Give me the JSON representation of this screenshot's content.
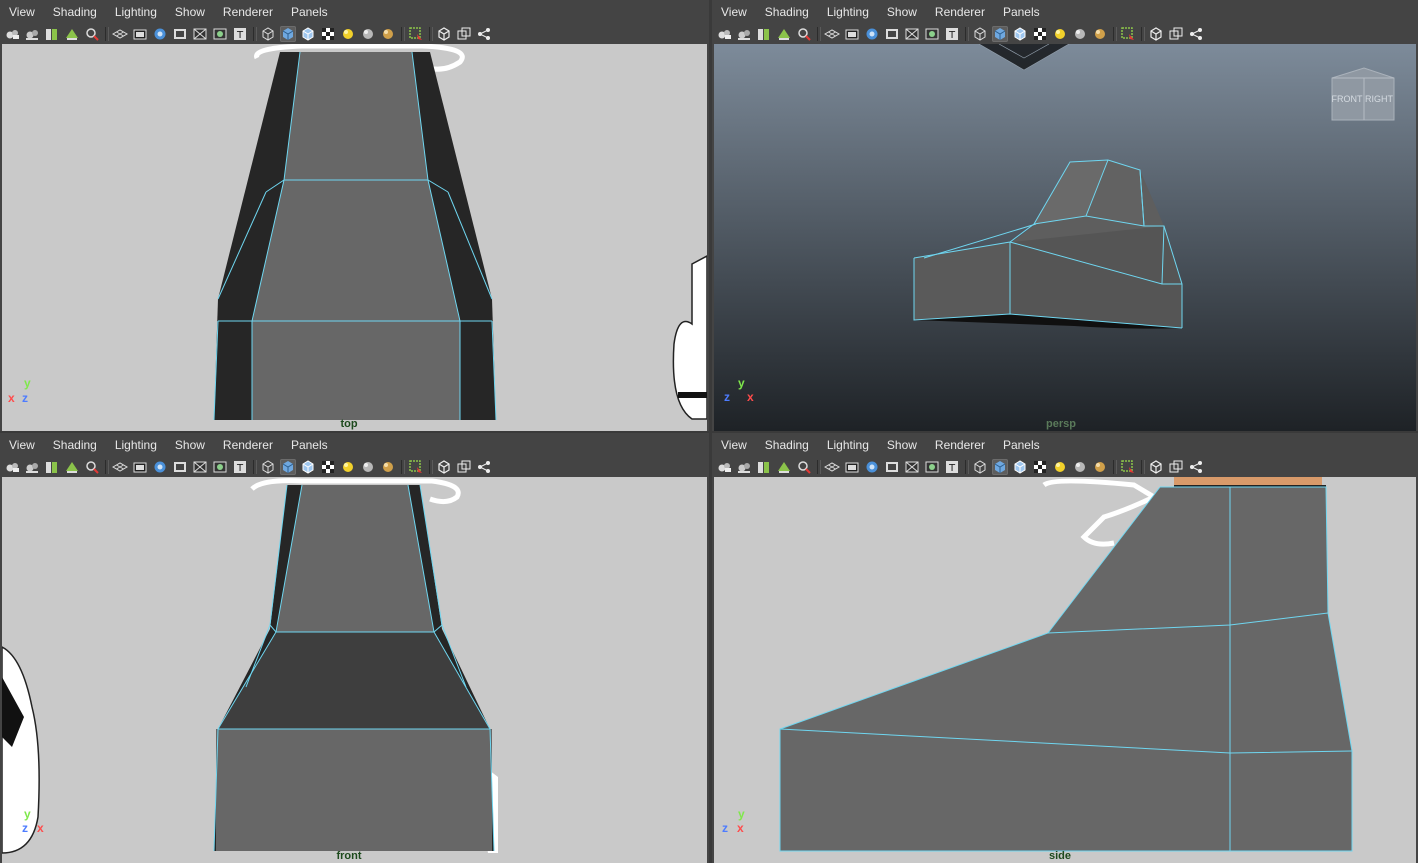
{
  "menu": [
    "View",
    "Shading",
    "Lighting",
    "Show",
    "Renderer",
    "Panels"
  ],
  "toolbar_icons": [
    "camera-icon",
    "camera-attributes-icon",
    "bookmark-icon",
    "image-plane-icon",
    "pan-zoom-icon",
    "grid-icon",
    "film-gate-icon",
    "resolution-gate-icon",
    "gate-mask-icon",
    "field-chart-icon",
    "safe-action-icon",
    "safe-title-icon",
    "wireframe-icon",
    "smooth-shade-icon",
    "wireframe-on-shaded-icon",
    "textured-icon",
    "default-light-icon",
    "shadows-icon",
    "ambient-occlusion-icon",
    "isolate-select-icon",
    "xray-icon",
    "xray-joints-icon",
    "xray-components-icon"
  ],
  "panels": {
    "top": {
      "label": "top",
      "axis": [
        "y",
        "x",
        "z"
      ]
    },
    "persp": {
      "label": "persp",
      "axis": [
        "y",
        "z",
        "x"
      ],
      "viewcube": [
        "FRONT",
        "RIGHT"
      ]
    },
    "front": {
      "label": "front",
      "axis": [
        "y",
        "z",
        "x"
      ]
    },
    "side": {
      "label": "side",
      "axis": [
        "y",
        "z",
        "x"
      ]
    }
  },
  "colors": {
    "wire": "#6fd6f0",
    "mesh_face": "#676767",
    "mesh_dark": "#262626",
    "ortho_bg": "#c9c9c9",
    "persp_bg_top": "#7d8b9a",
    "persp_bg_bottom": "#1e2226"
  }
}
